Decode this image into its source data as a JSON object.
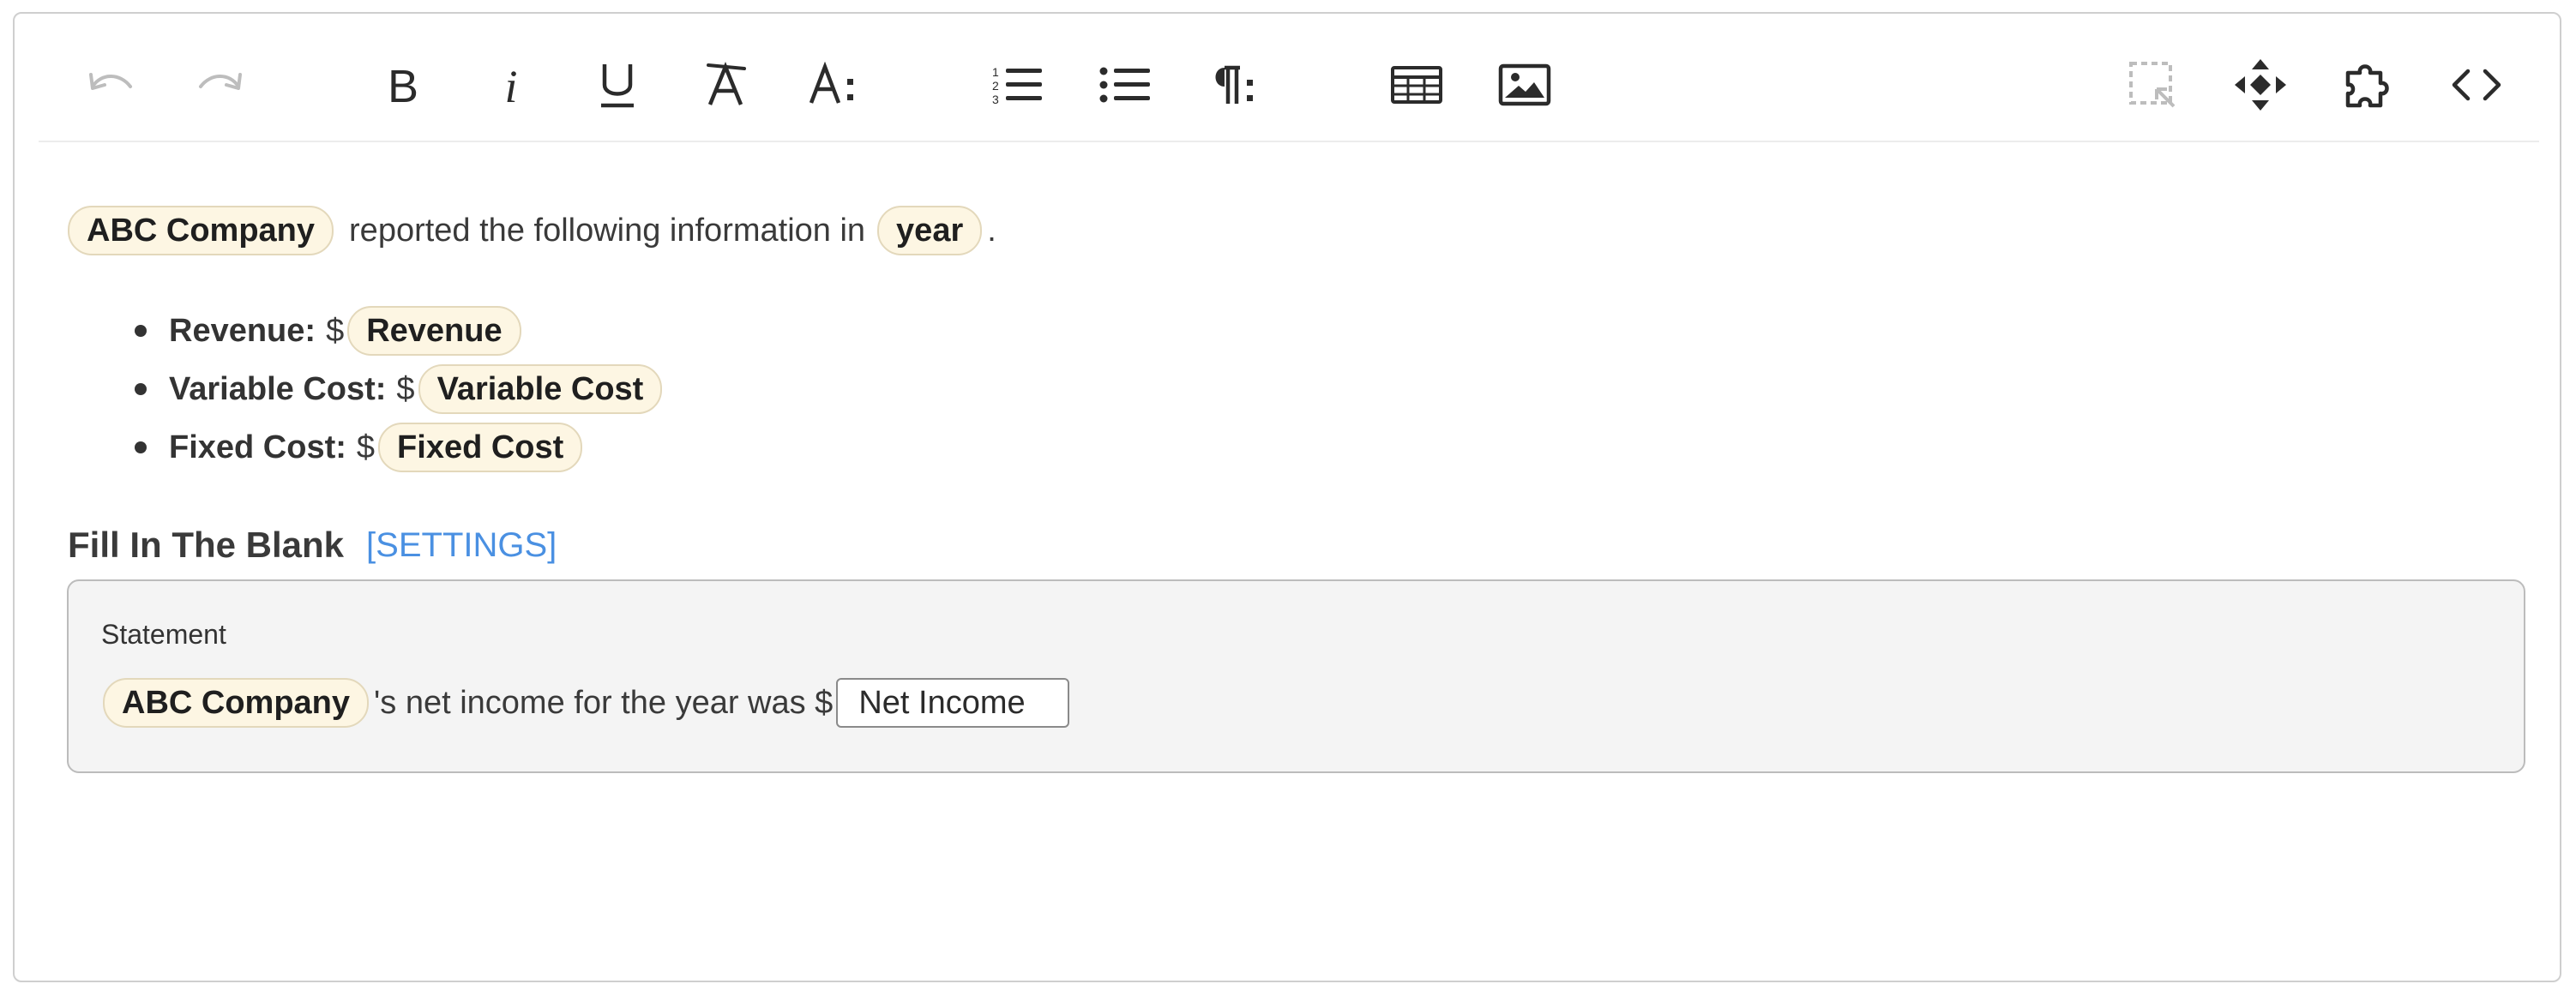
{
  "toolbar": {
    "buttons": [
      {
        "name": "undo",
        "icon": "undo-icon",
        "enabled": false
      },
      {
        "name": "redo",
        "icon": "redo-icon",
        "enabled": false
      },
      {
        "name": "bold",
        "icon": "bold-icon"
      },
      {
        "name": "italic",
        "icon": "italic-icon"
      },
      {
        "name": "underline",
        "icon": "underline-icon"
      },
      {
        "name": "clear-format",
        "icon": "clear-format-icon"
      },
      {
        "name": "font-size",
        "icon": "font-size-icon"
      },
      {
        "name": "ordered-list",
        "icon": "ordered-list-icon"
      },
      {
        "name": "bulleted-list",
        "icon": "bulleted-list-icon"
      },
      {
        "name": "paragraph",
        "icon": "paragraph-icon"
      },
      {
        "name": "table",
        "icon": "table-icon"
      },
      {
        "name": "image",
        "icon": "image-icon"
      },
      {
        "name": "select-element",
        "icon": "dashed-select-icon",
        "enabled": false
      },
      {
        "name": "move",
        "icon": "move-arrows-icon"
      },
      {
        "name": "plugin",
        "icon": "puzzle-icon"
      },
      {
        "name": "source-code",
        "icon": "code-icon"
      }
    ]
  },
  "intro": {
    "company_var": "ABC Company",
    "text": "reported the following information in",
    "year_var": "year",
    "end": "."
  },
  "bullets": [
    {
      "label": "Revenue:",
      "currency": "$",
      "var": "Revenue"
    },
    {
      "label": "Variable Cost:",
      "currency": "$",
      "var": "Variable Cost"
    },
    {
      "label": "Fixed Cost:",
      "currency": "$",
      "var": "Fixed Cost"
    }
  ],
  "fitb": {
    "title": "Fill In The Blank",
    "settings_label": "[SETTINGS]",
    "statement_label": "Statement",
    "company_var": "ABC Company",
    "statement_text": "'s net income for the year was $",
    "blank_value": "Net Income"
  },
  "colors": {
    "pill_bg": "#fdf6e3",
    "pill_border": "#e3d8bb",
    "link": "#4a90e2",
    "disabled_icon": "#bdbdbd"
  }
}
